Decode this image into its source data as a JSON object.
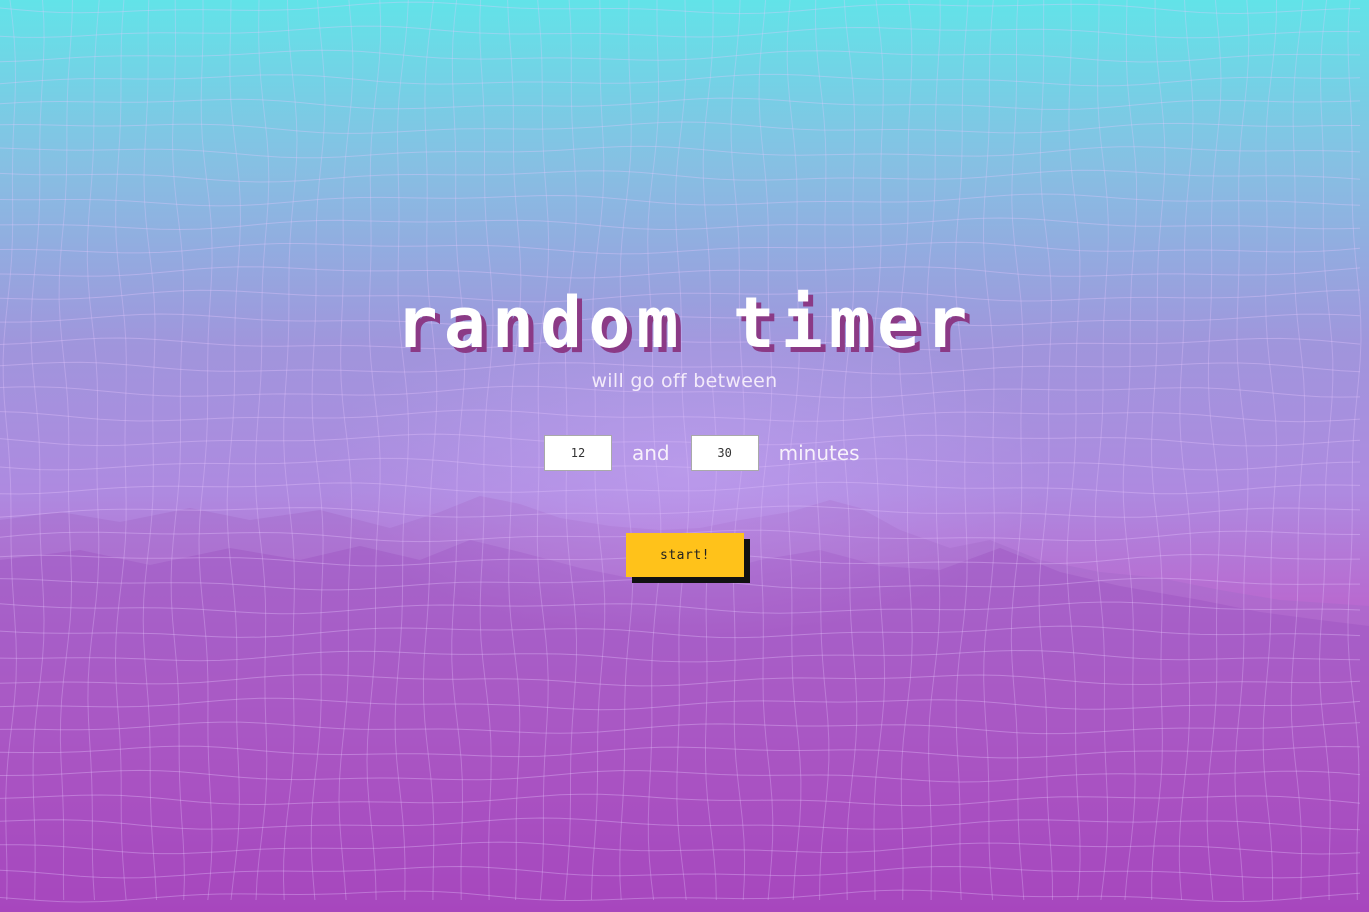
{
  "app": {
    "title": "random timer",
    "subtitle": "will go off between"
  },
  "range": {
    "min_value": "12",
    "connector": "and",
    "max_value": "30",
    "unit": "minutes"
  },
  "actions": {
    "start_label": "start!"
  },
  "colors": {
    "sky_top": "#62e3e8",
    "sky_mid": "#ae8ae0",
    "ground_bottom": "#b81cb0",
    "button": "#ffc21a",
    "title_shadow": "#8b3a86"
  }
}
